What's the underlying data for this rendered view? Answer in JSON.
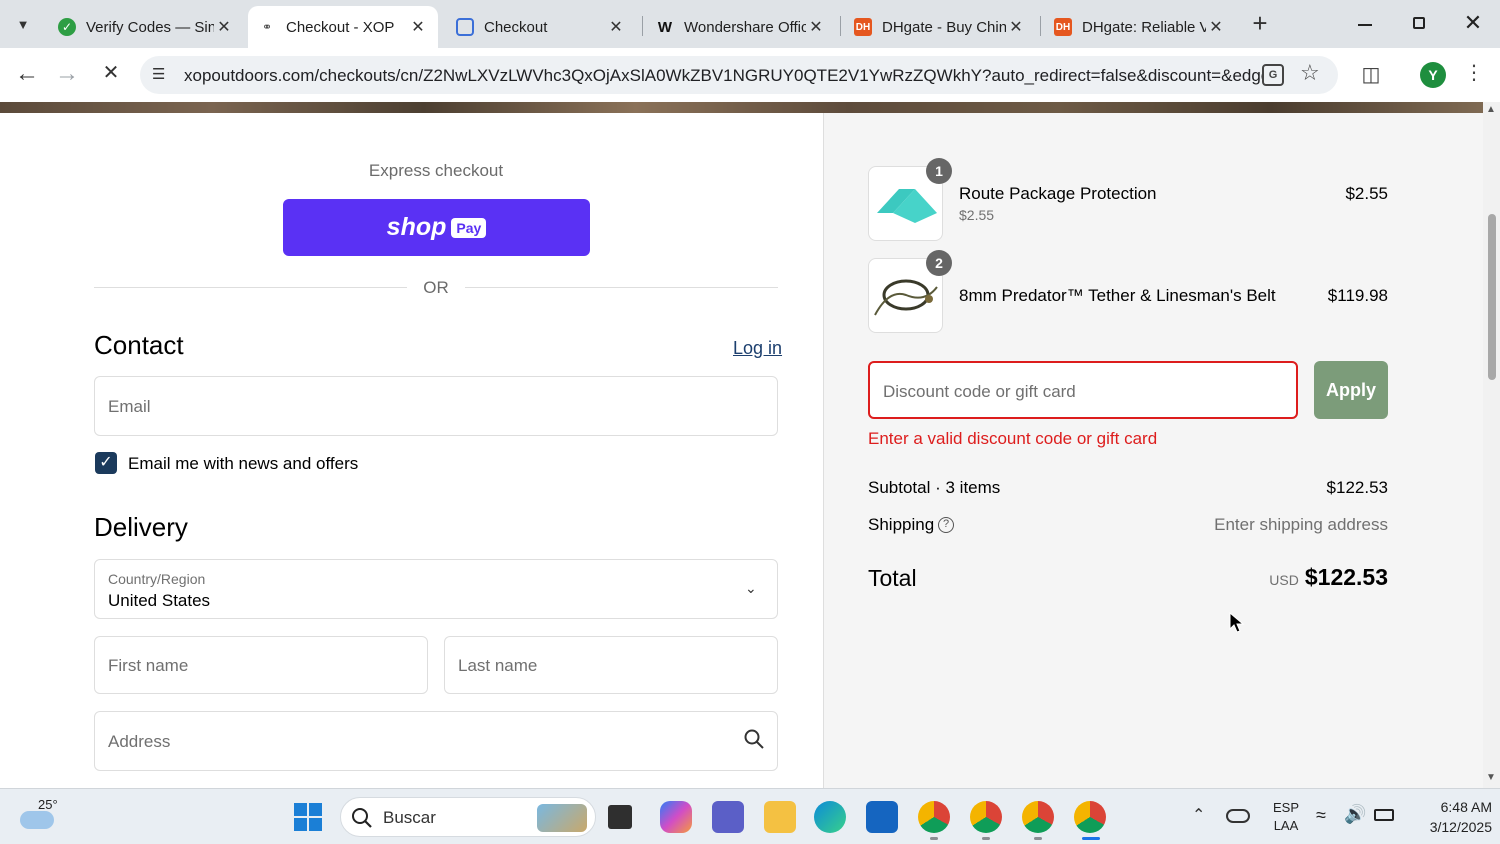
{
  "browser": {
    "tabs": [
      {
        "title": "Verify Codes — Sin",
        "favicon": "green-leaf-icon"
      },
      {
        "title": "Checkout - XOP",
        "favicon": "link-icon",
        "active": true
      },
      {
        "title": "Checkout",
        "favicon": "shield-icon"
      },
      {
        "title": "Wondershare Offic",
        "favicon": "wondershare-icon"
      },
      {
        "title": "DHgate - Buy Chin",
        "favicon": "dh-icon"
      },
      {
        "title": "DHgate: Reliable V",
        "favicon": "dh-icon"
      }
    ],
    "url": "xopoutdoors.com/checkouts/cn/Z2NwLXVzLWVhc3QxOjAxSlA0WkZBV1NGRUY0QTE2V1YwRzZQWkhY?auto_redirect=false&discount=&edge_re...",
    "profile_initial": "Y"
  },
  "checkout": {
    "express_title": "Express checkout",
    "shop_pay_label": "shop",
    "shop_pay_badge": "Pay",
    "or_label": "OR",
    "contact": {
      "heading": "Contact",
      "login_link": "Log in",
      "email_placeholder": "Email",
      "newsletter_label": "Email me with news and offers",
      "newsletter_checked": true
    },
    "delivery": {
      "heading": "Delivery",
      "country_label": "Country/Region",
      "country_value": "United States",
      "first_name_placeholder": "First name",
      "last_name_placeholder": "Last name",
      "address_placeholder": "Address"
    }
  },
  "summary": {
    "items": [
      {
        "qty": "1",
        "name": "Route Package Protection",
        "sub": "$2.55",
        "price": "$2.55"
      },
      {
        "qty": "2",
        "name": "8mm Predator™ Tether & Linesman's Belt",
        "sub": "",
        "price": "$119.98"
      }
    ],
    "discount_placeholder": "Discount code or gift card",
    "apply_label": "Apply",
    "discount_error": "Enter a valid discount code or gift card",
    "subtotal_label": "Subtotal · 3 items",
    "subtotal_value": "$122.53",
    "shipping_label": "Shipping",
    "shipping_value": "Enter shipping address",
    "total_label": "Total",
    "total_currency": "USD",
    "total_value": "$122.53"
  },
  "taskbar": {
    "weather_temp": "25°",
    "search_label": "Buscar",
    "lang_line1": "ESP",
    "lang_line2": "LAA",
    "time": "6:48 AM",
    "date": "3/12/2025"
  },
  "colors": {
    "shop_pay": "#5a31f4",
    "error": "#dd1d1d",
    "apply_bg": "#7c9c7a"
  }
}
